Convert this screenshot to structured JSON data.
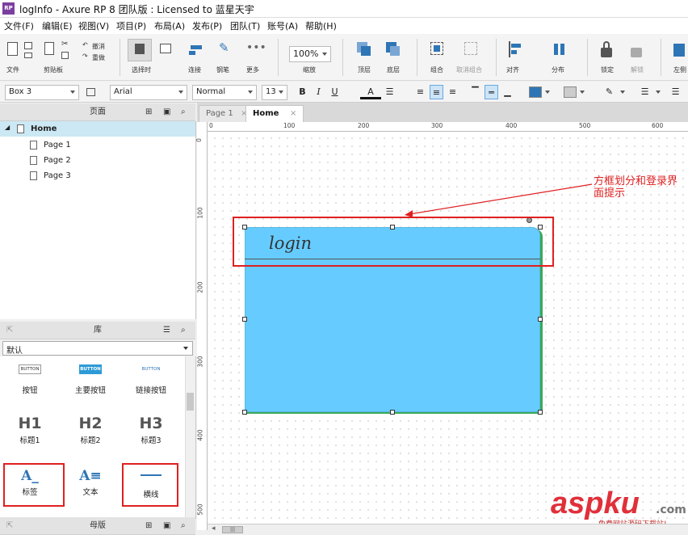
{
  "window": {
    "title": "logInfo - Axure RP 8 团队版 : Licensed to 蓝星天宇",
    "logo": "RP"
  },
  "menu": [
    "文件(F)",
    "编辑(E)",
    "视图(V)",
    "项目(P)",
    "布局(A)",
    "发布(P)",
    "团队(T)",
    "账号(A)",
    "帮助(H)"
  ],
  "toolbar": {
    "file": "文件",
    "clipboard": "剪贴板",
    "undo": "撤消",
    "redo": "重做",
    "select": "选择时",
    "connect": "连接",
    "pen": "钢笔",
    "more": "更多",
    "zoom": "100%",
    "zoom_label": "缩放",
    "top": "顶层",
    "bottom": "底层",
    "group": "组合",
    "ungroup": "取消组合",
    "align": "对齐",
    "distribute": "分布",
    "lock": "锁定",
    "unlock": "解锁",
    "left": "左侧"
  },
  "format": {
    "widget": "Box 3",
    "font": "Arial",
    "style": "Normal",
    "size": "13",
    "bold": "B",
    "italic": "I",
    "underline": "U",
    "text_color": "A"
  },
  "pages_panel": {
    "title": "页面",
    "home": "Home",
    "pages": [
      "Page 1",
      "Page 2",
      "Page 3"
    ]
  },
  "library_panel": {
    "title": "库",
    "selected": "默认",
    "items": [
      {
        "preview": "BUTTON",
        "label": "按钮"
      },
      {
        "preview": "BUTTON",
        "label": "主要按钮"
      },
      {
        "preview": "BUTTON",
        "label": "链接按钮"
      },
      {
        "preview": "H1",
        "label": "标题1"
      },
      {
        "preview": "H2",
        "label": "标题2"
      },
      {
        "preview": "H3",
        "label": "标题3"
      },
      {
        "label": "标签"
      },
      {
        "label": "文本"
      },
      {
        "label": "横线"
      }
    ]
  },
  "masters_panel": {
    "title": "母版"
  },
  "tabs": [
    {
      "label": "Page 1"
    },
    {
      "label": "Home"
    }
  ],
  "ruler": {
    "h": [
      "0",
      "100",
      "200",
      "300",
      "400",
      "500",
      "600"
    ],
    "v": [
      "0",
      "100",
      "200",
      "300",
      "400",
      "500"
    ]
  },
  "canvas": {
    "widget_text": "login",
    "annotation": "方框划分和登录界面提示",
    "box_color": "#66ccff",
    "annotation_color": "#e02020"
  },
  "watermark": {
    "brand": "aspku",
    "domain": ".com",
    "tagline": "免费网站源码下载站!"
  },
  "scroll": {
    "grip": "|||"
  }
}
